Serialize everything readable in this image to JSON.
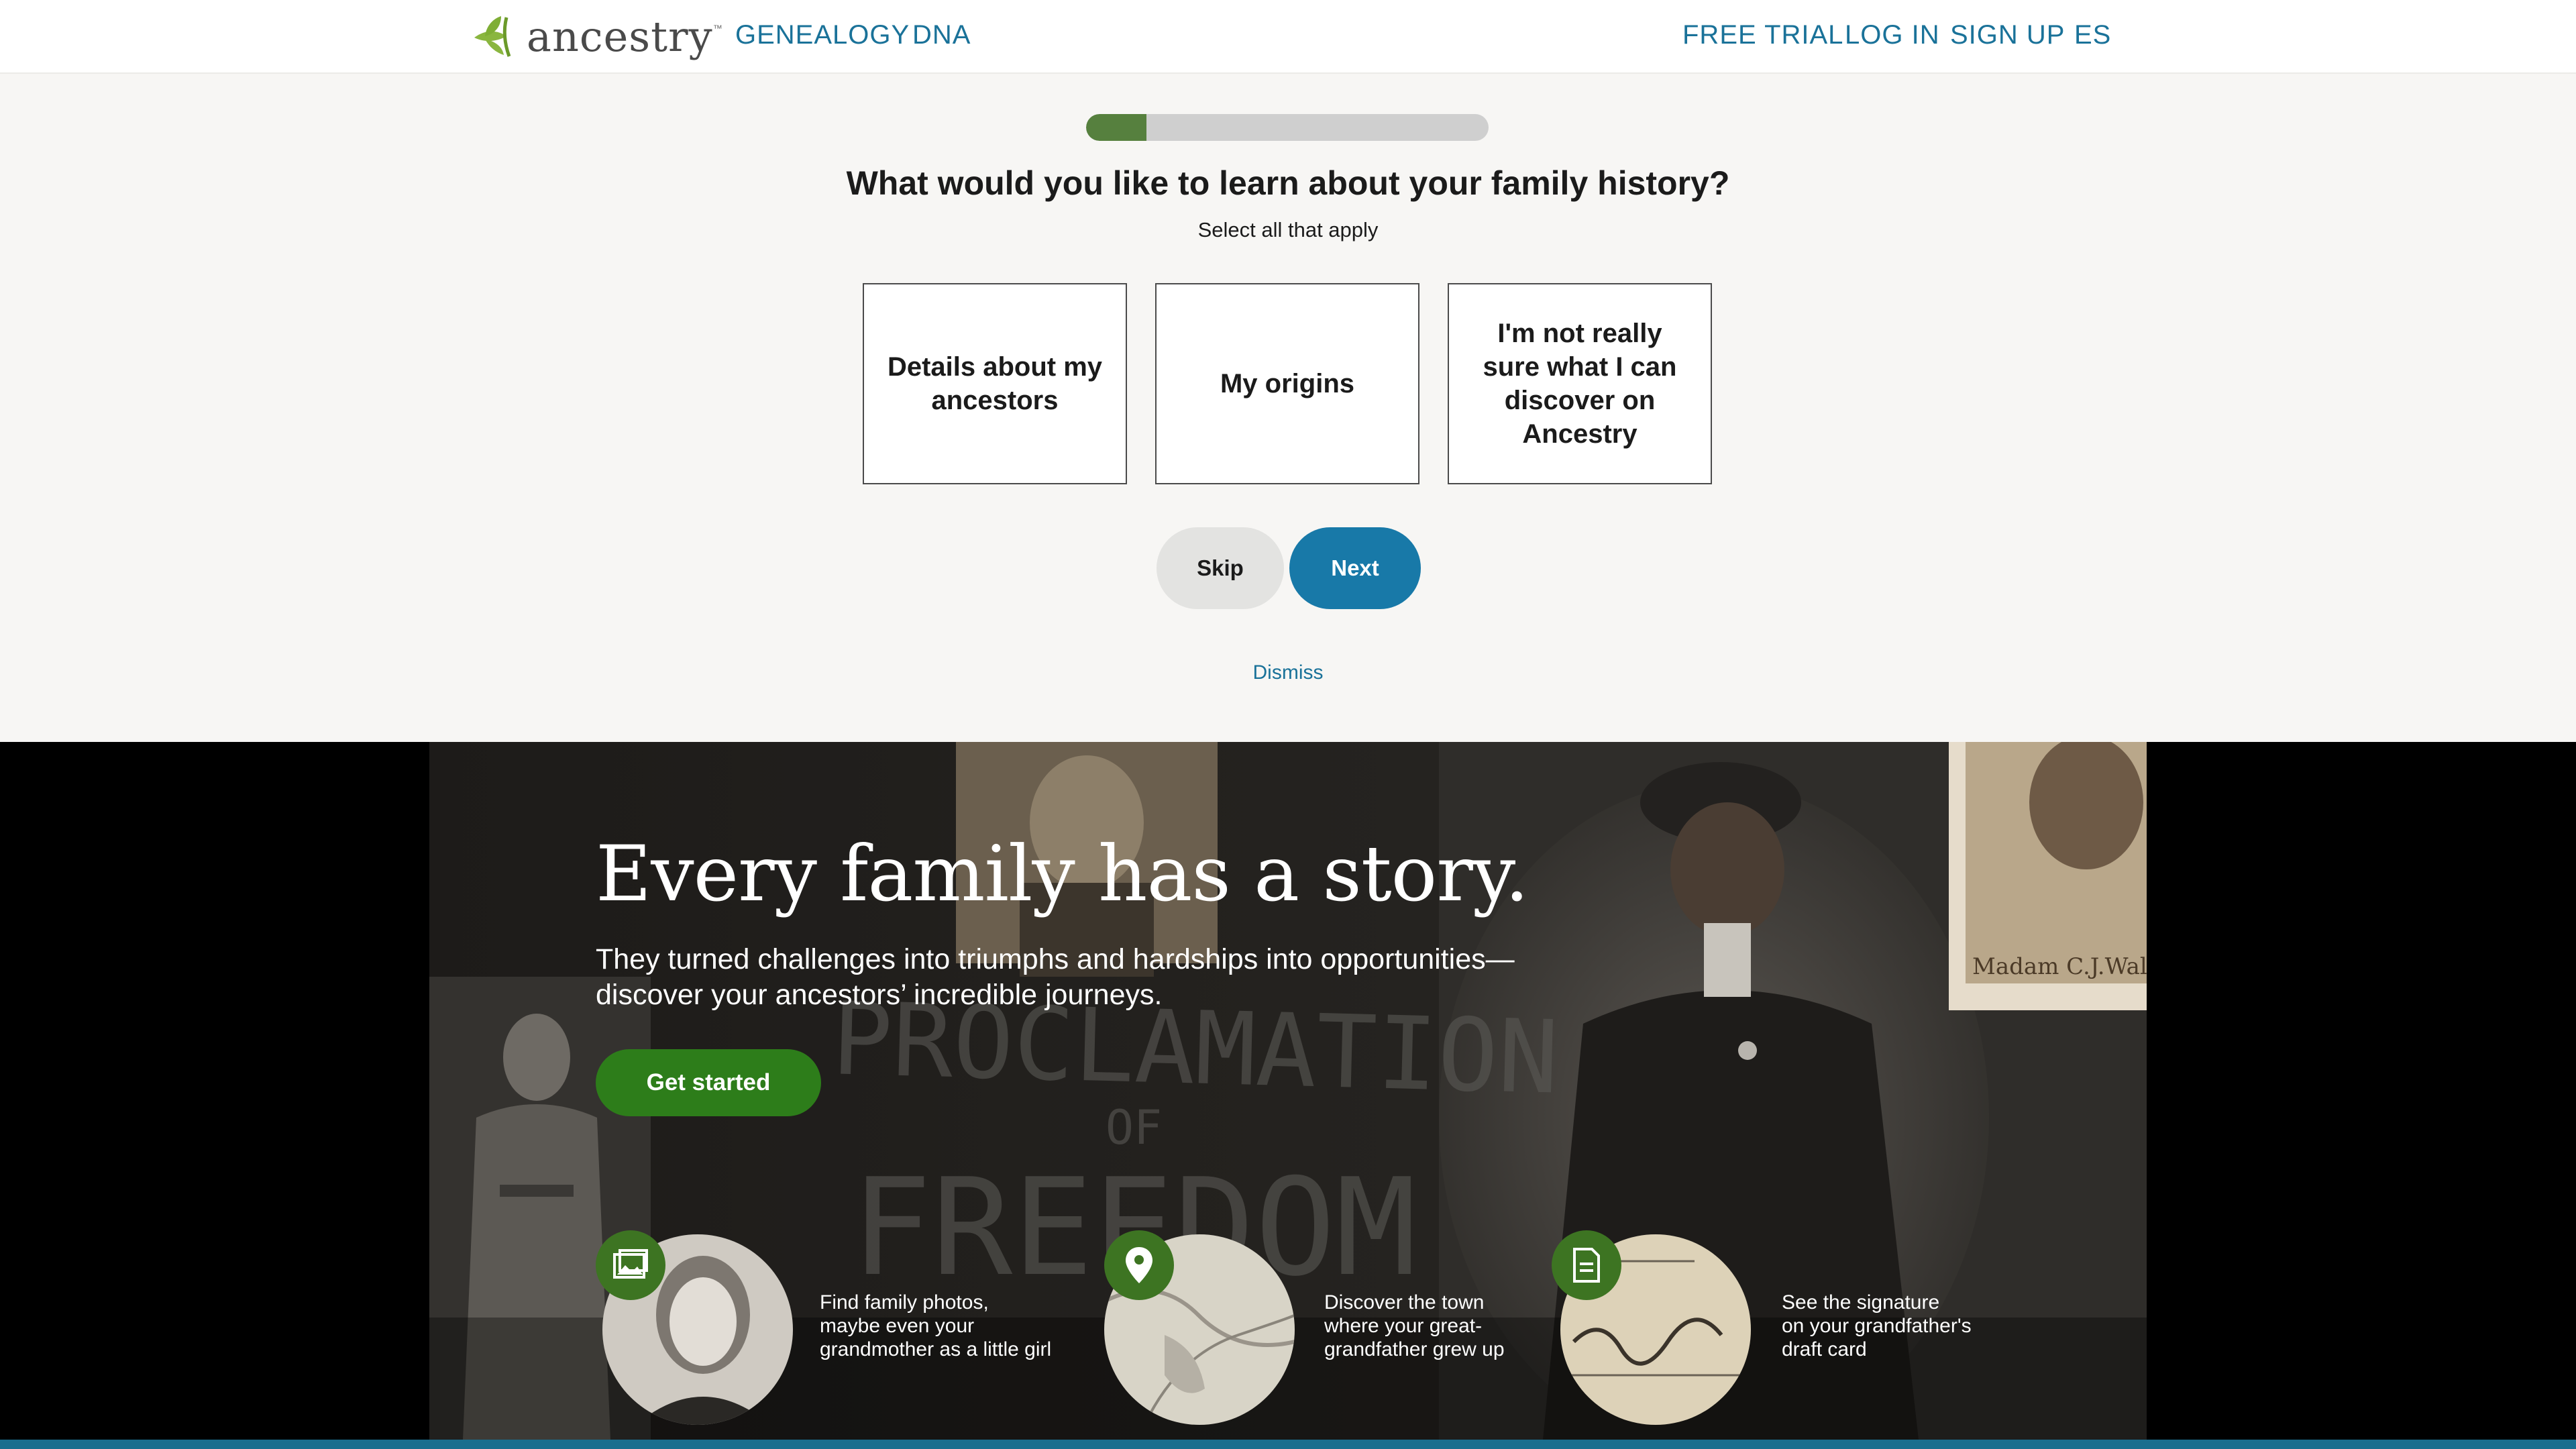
{
  "header": {
    "logo_text": "ancestry",
    "nav_left": [
      "GENEALOGY",
      "DNA"
    ],
    "nav_right": [
      "FREE TRIAL",
      "LOG IN",
      "SIGN UP",
      "ES"
    ]
  },
  "survey": {
    "progress": 0.15,
    "question": "What would you like to learn about your family history?",
    "hint": "Select all that apply",
    "options": [
      "Details about my ancestors",
      "My origins",
      "I'm not really sure what I can discover on Ancestry"
    ],
    "skip_label": "Skip",
    "next_label": "Next",
    "dismiss_label": "Dismiss"
  },
  "hero": {
    "title": "Every family has a story.",
    "subtitle": "They turned challenges into triumphs and hardships into opportunities—discover your ancestors’ incredible journeys.",
    "cta_label": "Get started",
    "background_text": [
      "PROCLAMATION",
      "OF",
      "FREEDOM"
    ],
    "stamp_text": "Madam C.J.Wal",
    "features": [
      {
        "icon": "photo-icon",
        "text": "Find family photos,\nmaybe even your\ngrandmother as a little girl"
      },
      {
        "icon": "map-pin-icon",
        "text": "Discover the town\nwhere your great-\ngrandfather grew up"
      },
      {
        "icon": "document-icon",
        "text": "See the signature\non your grandfather's\ndraft card"
      }
    ]
  },
  "colors": {
    "brand_blue": "#1879a8",
    "brand_green": "#2d7d1a",
    "progress_green": "#56803e",
    "link_blue": "#1a7299"
  }
}
